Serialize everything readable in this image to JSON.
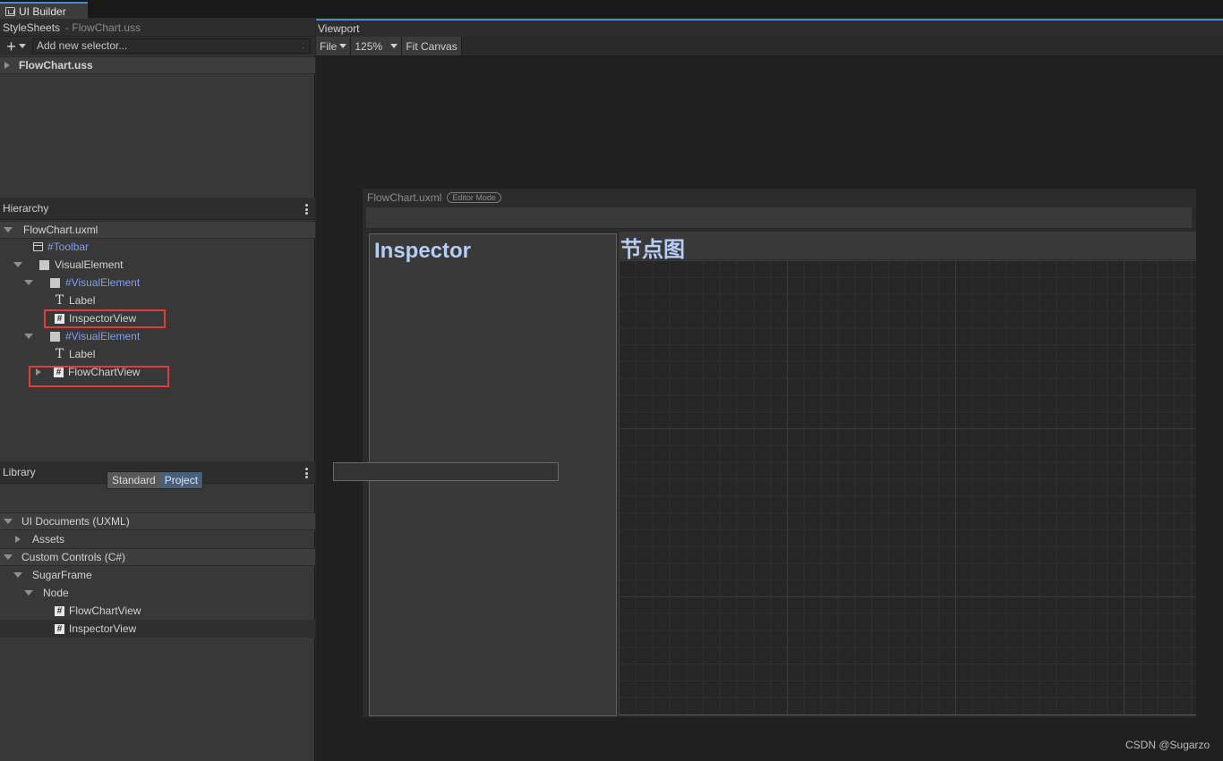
{
  "window": {
    "tab_title": "UI Builder"
  },
  "stylesheets": {
    "header": "StyleSheets",
    "header_sub": "- FlowChart.uss",
    "selector_placeholder": "Add new selector...",
    "selector_dots": ":",
    "add_symbol": "+",
    "files": [
      "FlowChart.uss"
    ]
  },
  "hierarchy": {
    "header": "Hierarchy",
    "items": [
      {
        "label": "FlowChart.uxml"
      },
      {
        "label": "#Toolbar"
      },
      {
        "label": "VisualElement"
      },
      {
        "label": "#VisualElement"
      },
      {
        "label": "Label"
      },
      {
        "label": "InspectorView"
      },
      {
        "label": "#VisualElement"
      },
      {
        "label": "Label"
      },
      {
        "label": "FlowChartView"
      }
    ]
  },
  "library": {
    "header": "Library",
    "toggle": {
      "standard": "Standard",
      "project": "Project",
      "selected": "Project"
    },
    "items": [
      {
        "label": "UI Documents (UXML)"
      },
      {
        "label": "Assets"
      },
      {
        "label": "Custom Controls (C#)"
      },
      {
        "label": "SugarFrame"
      },
      {
        "label": "Node"
      },
      {
        "label": "FlowChartView"
      },
      {
        "label": "InspectorView"
      }
    ]
  },
  "viewport": {
    "header": "Viewport",
    "toolbar": {
      "file": "File",
      "zoom": "125%",
      "fit": "Fit Canvas"
    },
    "canvas_title": "FlowChart.uxml",
    "mode_badge": "Editor Mode",
    "inspector_label": "Inspector",
    "nodegraph_label": "节点图"
  },
  "watermark": "CSDN @Sugarzo",
  "colors": {
    "accent": "#4b8cd3",
    "highlight_box": "#e03c3c",
    "label_blue": "#b6cdf5",
    "hierarchy_blue": "#7f9ff2"
  }
}
